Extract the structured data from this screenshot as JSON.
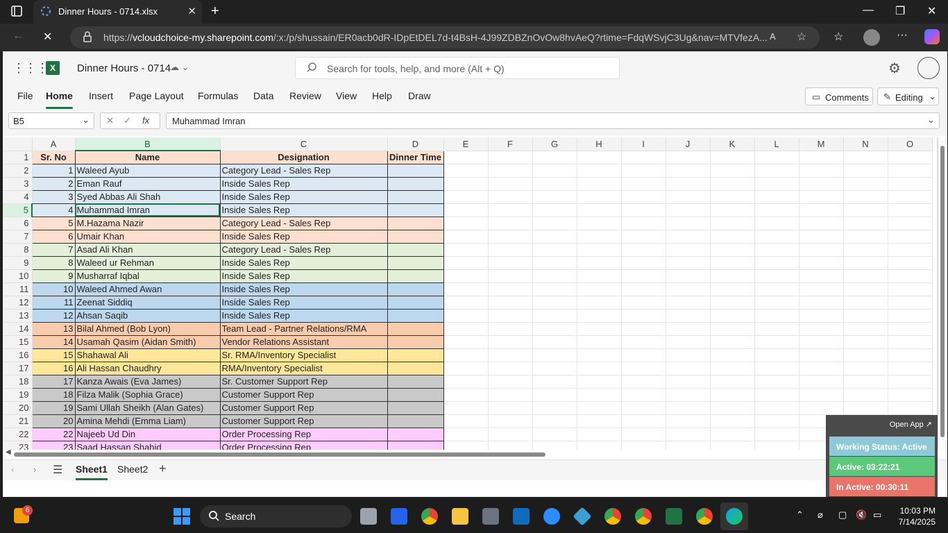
{
  "browser": {
    "tab_title": "Dinner Hours - 0714.xlsx",
    "url_prefix": "https://",
    "url_host": "vcloudchoice-my.sharepoint.com",
    "url_path": "/:x:/p/shussain/ER0acb0dR-IDpEtDEL7d-t4BsH-4J99ZDBZnOvOw8hvAeQ?rtime=FdqWSvjC3Ug&nav=MTVfezA..."
  },
  "app": {
    "doc_title": "Dinner Hours - 0714",
    "search_placeholder": "Search for tools, help, and more (Alt + Q)",
    "comments_label": "Comments",
    "editing_label": "Editing",
    "accent": "#217346"
  },
  "ribbon": {
    "tabs": [
      "File",
      "Home",
      "Insert",
      "Page Layout",
      "Formulas",
      "Data",
      "Review",
      "View",
      "Help",
      "Draw"
    ],
    "active": "Home"
  },
  "formula_bar": {
    "name_box": "B5",
    "fx_label": "fx",
    "value": "Muhammad Imran"
  },
  "grid": {
    "columns": [
      "A",
      "B",
      "C",
      "D",
      "E",
      "F",
      "G",
      "H",
      "I",
      "J",
      "K",
      "L",
      "M",
      "N",
      "O"
    ],
    "selected_column": "B",
    "selected_row": "5",
    "header_row": {
      "row": "1",
      "a": "Sr. No",
      "b": "Name",
      "c": "Designation",
      "d": "Dinner Time",
      "color": "#fbe0d0"
    },
    "rows": [
      {
        "row": "2",
        "a": "1",
        "b": "Waleed Ayub",
        "c": "Category Lead - Sales Rep",
        "color": "#dce9f5"
      },
      {
        "row": "3",
        "a": "2",
        "b": "Eman Rauf",
        "c": "Inside Sales Rep",
        "color": "#dce9f5"
      },
      {
        "row": "4",
        "a": "3",
        "b": "Syed Abbas Ali Shah",
        "c": "Inside Sales Rep",
        "color": "#dce9f5"
      },
      {
        "row": "5",
        "a": "4",
        "b": "Muhammad Imran",
        "c": "Inside Sales Rep",
        "color": "#dce9f5"
      },
      {
        "row": "6",
        "a": "5",
        "b": "M.Hazama Nazir",
        "c": "Category Lead - Sales Rep",
        "color": "#fbe0d0"
      },
      {
        "row": "7",
        "a": "6",
        "b": "Umair Khan",
        "c": "Inside Sales Rep",
        "color": "#fbe0d0"
      },
      {
        "row": "8",
        "a": "7",
        "b": "Asad Ali Khan",
        "c": "Category Lead - Sales Rep",
        "color": "#e2efd9"
      },
      {
        "row": "9",
        "a": "8",
        "b": "Waleed ur Rehman",
        "c": "Inside Sales Rep",
        "color": "#e2efd9"
      },
      {
        "row": "10",
        "a": "9",
        "b": "Musharraf Iqbal",
        "c": "Inside Sales Rep",
        "color": "#e2efd9"
      },
      {
        "row": "11",
        "a": "10",
        "b": "Waleed Ahmed Awan",
        "c": "Inside Sales Rep",
        "color": "#bdd7ee"
      },
      {
        "row": "12",
        "a": "11",
        "b": "Zeenat Siddiq",
        "c": "Inside Sales Rep",
        "color": "#bdd7ee"
      },
      {
        "row": "13",
        "a": "12",
        "b": "Ahsan Saqib",
        "c": "Inside Sales Rep",
        "color": "#bdd7ee"
      },
      {
        "row": "14",
        "a": "13",
        "b": "Bilal Ahmed (Bob Lyon)",
        "c": "Team Lead - Partner Relations/RMA",
        "color": "#f8cbad"
      },
      {
        "row": "15",
        "a": "14",
        "b": "Usamah Qasim (Aidan Smith)",
        "c": "Vendor Relations Assistant",
        "color": "#f8cbad"
      },
      {
        "row": "16",
        "a": "15",
        "b": "Shahawal Ali",
        "c": "Sr. RMA/Inventory Specialist",
        "color": "#ffe699"
      },
      {
        "row": "17",
        "a": "16",
        "b": "Ali Hassan Chaudhry",
        "c": "RMA/Inventory Specialist",
        "color": "#ffe699"
      },
      {
        "row": "18",
        "a": "17",
        "b": "Kanza Awais (Eva James)",
        "c": "Sr. Customer Support Rep",
        "color": "#c9c9c9"
      },
      {
        "row": "19",
        "a": "18",
        "b": "Filza Malik (Sophia Grace)",
        "c": "Customer Support Rep",
        "color": "#c9c9c9"
      },
      {
        "row": "20",
        "a": "19",
        "b": "Sami Ullah Sheikh (Alan Gates)",
        "c": "Customer Support Rep",
        "color": "#c9c9c9"
      },
      {
        "row": "21",
        "a": "20",
        "b": "Amina Mehdi (Emma Liam)",
        "c": "Customer Support Rep",
        "color": "#c9c9c9"
      },
      {
        "row": "22",
        "a": "22",
        "b": "Najeeb Ud Din",
        "c": "Order Processing Rep",
        "color": "#ffccff"
      },
      {
        "row": "23",
        "a": "23",
        "b": "Saad Hassan Shahid",
        "c": "Order Processing Rep",
        "color": "#ffccff"
      }
    ]
  },
  "sheets": {
    "tabs": [
      "Sheet1",
      "Sheet2"
    ],
    "active": "Sheet1"
  },
  "popup": {
    "open_app": "Open App ↗",
    "working_status": "Working Status: Active",
    "active": "Active: 03:22:21",
    "inactive": "In Active: 00:30:11"
  },
  "taskbar": {
    "search_label": "Search",
    "time": "10:03 PM",
    "date": "7/14/2025",
    "widget_badge": "6"
  }
}
